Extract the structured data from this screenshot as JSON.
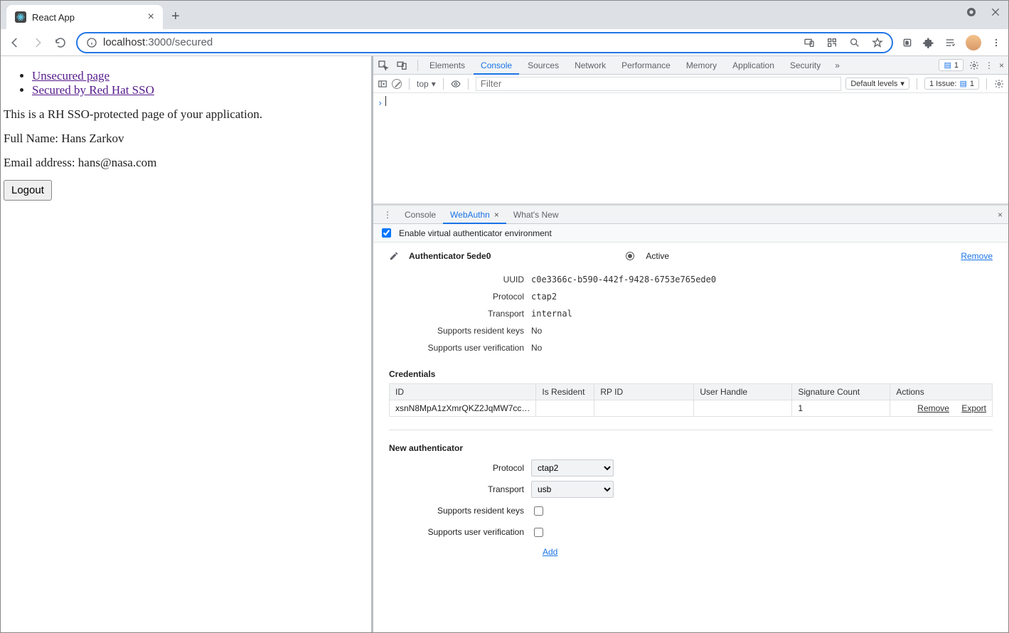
{
  "browser": {
    "tab_title": "React App",
    "url_host_dark": "localhost",
    "url_host_muted": ":3000/secured"
  },
  "page": {
    "link_unsecured": "Unsecured page",
    "link_secured": "Secured by Red Hat SSO",
    "desc": "This is a RH SSO-protected page of your application.",
    "fullname": "Full Name: Hans Zarkov",
    "email": "Email address: hans@nasa.com",
    "logout": "Logout"
  },
  "devtools": {
    "tabs": [
      "Elements",
      "Console",
      "Sources",
      "Network",
      "Performance",
      "Memory",
      "Application",
      "Security"
    ],
    "active_tab": "Console",
    "badge_count": "1",
    "filter_placeholder": "Filter",
    "context": "top",
    "levels": "Default levels",
    "issue_label": "1 Issue:",
    "issue_count": "1"
  },
  "drawer": {
    "tabs": [
      "Console",
      "WebAuthn",
      "What's New"
    ],
    "active_tab": "WebAuthn",
    "enable_label": "Enable virtual authenticator environment",
    "auth_title_prefix": "Authenticator",
    "auth_id_short": "5ede0",
    "active_label": "Active",
    "remove_label": "Remove",
    "props": {
      "uuid_label": "UUID",
      "uuid": "c0e3366c-b590-442f-9428-6753e765ede0",
      "protocol_label": "Protocol",
      "protocol": "ctap2",
      "transport_label": "Transport",
      "transport": "internal",
      "resident_label": "Supports resident keys",
      "resident": "No",
      "userver_label": "Supports user verification",
      "userver": "No"
    },
    "credentials_title": "Credentials",
    "cred_headers": [
      "ID",
      "Is Resident",
      "RP ID",
      "User Handle",
      "Signature Count",
      "Actions"
    ],
    "cred_row": {
      "id": "xsnN8MpA1zXmrQKZ2JqMW7cc…",
      "is_resident": "",
      "rp_id": "",
      "user_handle": "",
      "sig_count": "1",
      "action_remove": "Remove",
      "action_export": "Export"
    },
    "new_auth_title": "New authenticator",
    "form": {
      "protocol_label": "Protocol",
      "protocol_value": "ctap2",
      "transport_label": "Transport",
      "transport_value": "usb",
      "resident_label": "Supports resident keys",
      "userver_label": "Supports user verification",
      "add_label": "Add"
    }
  }
}
